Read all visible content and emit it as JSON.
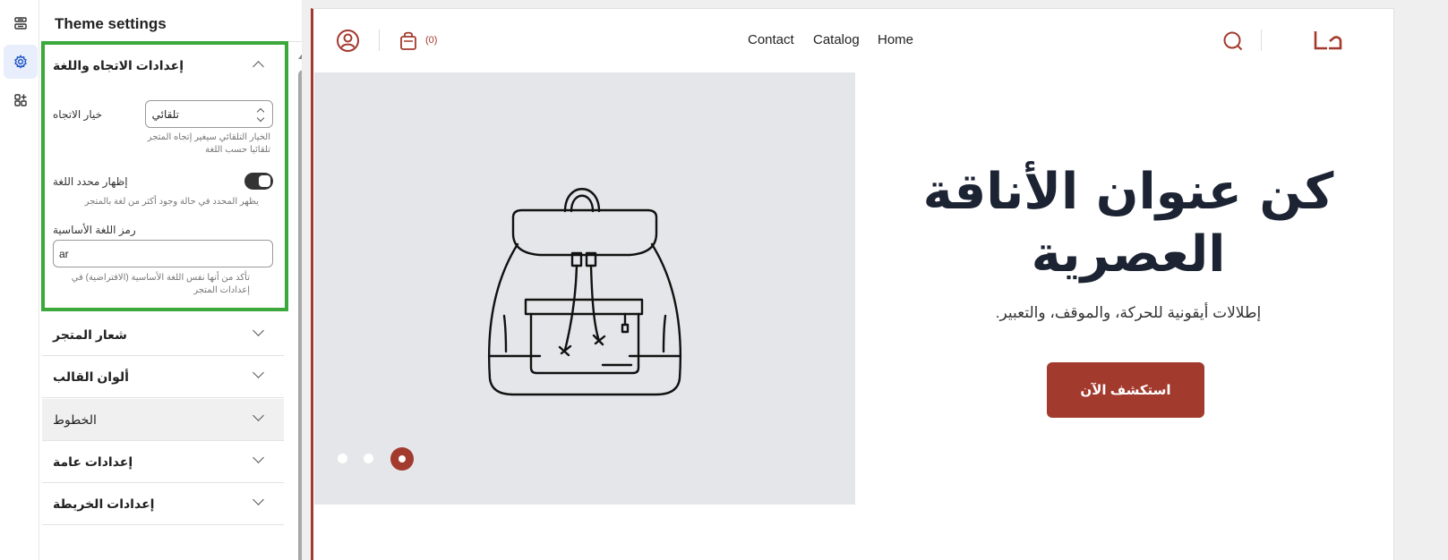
{
  "sidebar": {
    "rail_icons": [
      "sections-icon",
      "gear-icon",
      "apps-icon"
    ]
  },
  "panel": {
    "title": "Theme settings",
    "open_section": {
      "title": "إعدادات الاتجاه واللغة",
      "direction_label": "خيار الاتجاه",
      "direction_value": "تلقائي",
      "direction_help": "الخيار التلقائي سيغير إتجاه المتجر تلقائيا حسب اللغة",
      "lang_switch_label": "إظهار محدد اللغة",
      "lang_switch_help": "يظهر المحدد في حالة وجود أكثر من لغة بالمتجر",
      "lang_switch_on": true,
      "lang_code_label": "رمز اللغة الأساسية",
      "lang_code_value": "ar",
      "lang_code_help": "تأكد من أنها نفس اللغة الأساسية (الافتراضية) في إعدادات المتجر"
    },
    "sections": [
      {
        "title": "شعار المتجر"
      },
      {
        "title": "ألوان القالب"
      },
      {
        "title": "الخطوط"
      },
      {
        "title": "إعدادات عامة"
      },
      {
        "title": "إعدادات الخريطة"
      }
    ]
  },
  "preview": {
    "header": {
      "cart_count": "(0)",
      "nav": [
        "Contact",
        "Catalog",
        "Home"
      ]
    },
    "hero": {
      "title": "كن عنوان الأناقة العصرية",
      "subtitle": "إطلالات أيقونية للحركة، والموقف، والتعبير.",
      "cta": "استكشف الآن",
      "slide_count": 3,
      "active_slide": 3
    },
    "colors": {
      "accent": "#a33a2e",
      "highlight": "#3aa83b"
    }
  }
}
